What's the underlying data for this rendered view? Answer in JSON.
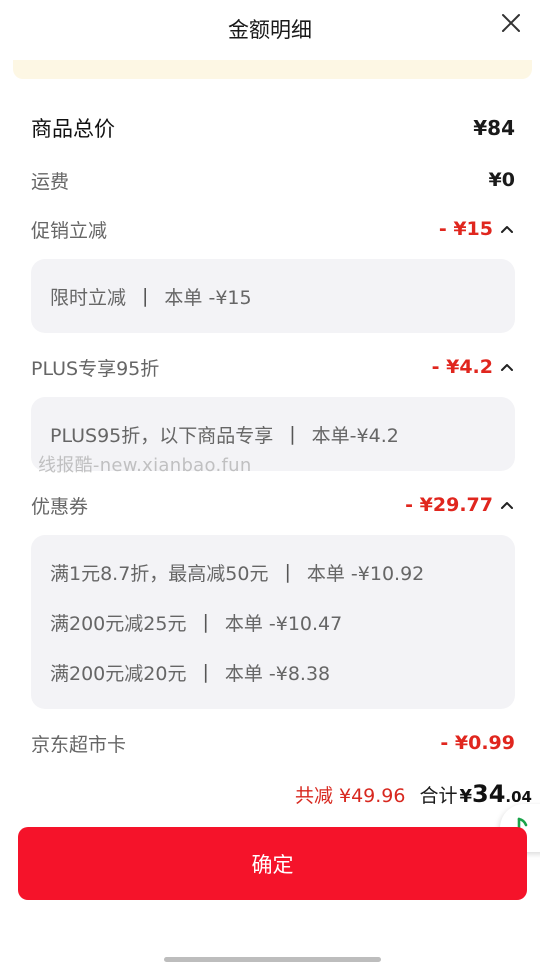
{
  "header": {
    "title": "金额明细"
  },
  "rows": {
    "total": {
      "label": "商品总价",
      "amount": "¥84"
    },
    "shipping": {
      "label": "运费",
      "amount": "¥0"
    },
    "promo": {
      "label": "促销立减",
      "amount": "- ¥15"
    },
    "plus": {
      "label": "PLUS专享95折",
      "amount": "- ¥4.2"
    },
    "coupon": {
      "label": "优惠券",
      "amount": "- ¥29.77"
    },
    "card": {
      "label": "京东超市卡",
      "amount": "- ¥0.99"
    }
  },
  "promo_details": [
    {
      "desc": "限时立减",
      "sep": "|",
      "value": "本单 -¥15"
    }
  ],
  "plus_details": [
    {
      "desc": "PLUS95折，以下商品专享",
      "sep": "|",
      "value": "本单-¥4.2"
    }
  ],
  "coupon_details": [
    {
      "desc": "满1元8.7折，最高减50元",
      "sep": "|",
      "value": "本单 -¥10.92"
    },
    {
      "desc": "满200元减25元",
      "sep": "|",
      "value": "本单 -¥10.47"
    },
    {
      "desc": "满200元减20元",
      "sep": "|",
      "value": "本单 -¥8.38"
    }
  ],
  "watermark": "线报酷-new.xianbao.fun",
  "summary": {
    "saved": "共减 ¥49.96",
    "total_label": "合计",
    "currency": "¥",
    "total_int": "34",
    "total_dec": ".04"
  },
  "confirm_label": "确定",
  "colors": {
    "accent": "#f5132a",
    "discount": "#e0261e",
    "music_icon": "#1aa34a"
  },
  "icons": {
    "close": "close-icon",
    "caret": "chevron-up-icon",
    "music": "music-note-icon"
  }
}
